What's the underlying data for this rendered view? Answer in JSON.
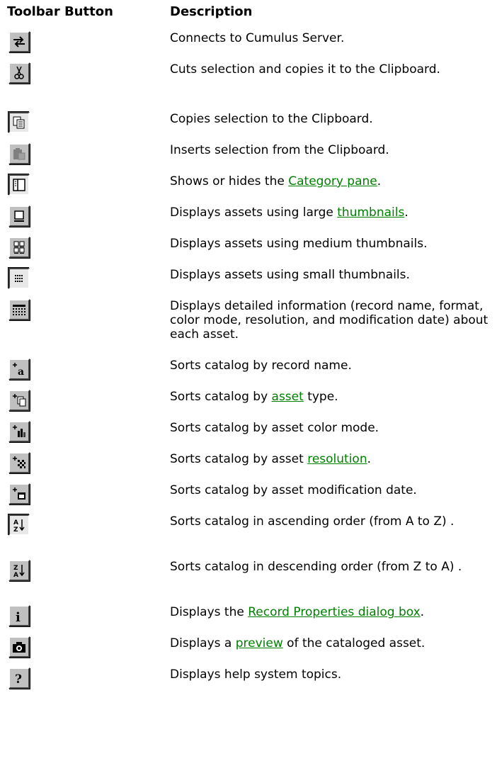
{
  "header": {
    "button_col": "Toolbar Button",
    "desc_col": "Description"
  },
  "rows": [
    {
      "icon": "connect-arrows-icon",
      "pre": "Connects to Cumulus Server.",
      "link": "",
      "post": ""
    },
    {
      "icon": "scissors-icon",
      "pre": "Cuts selection and copies it to the Clipboard.",
      "link": "",
      "post": ""
    },
    {
      "icon": "copy-icon",
      "pre": "Copies selection to the Clipboard.",
      "link": "",
      "post": ""
    },
    {
      "icon": "paste-icon",
      "pre": "Inserts selection from the Clipboard.",
      "link": "",
      "post": ""
    },
    {
      "icon": "category-pane-icon",
      "pre": "Shows or hides the ",
      "link": "Category pane",
      "post": "."
    },
    {
      "icon": "large-thumbnail-icon",
      "pre": "Displays assets using large ",
      "link": "thumbnails",
      "post": "."
    },
    {
      "icon": "medium-thumbnails-icon",
      "pre": "Displays assets using medium thumbnails.",
      "link": "",
      "post": ""
    },
    {
      "icon": "small-thumbnails-icon",
      "pre": "Displays assets using small thumbnails.",
      "link": "",
      "post": ""
    },
    {
      "icon": "details-list-icon",
      "pre": "Displays detailed information (record name, format, color mode, resolution, and modification date) about each asset.",
      "link": "",
      "post": ""
    },
    {
      "icon": "sort-name-icon",
      "pre": "Sorts catalog by record name.",
      "link": "",
      "post": ""
    },
    {
      "icon": "sort-type-icon",
      "pre": "Sorts catalog by ",
      "link": "asset",
      "post": " type."
    },
    {
      "icon": "sort-color-mode-icon",
      "pre": "Sorts catalog by asset color mode.",
      "link": "",
      "post": ""
    },
    {
      "icon": "sort-resolution-icon",
      "pre": "Sorts catalog by asset ",
      "link": "resolution",
      "post": "."
    },
    {
      "icon": "sort-date-icon",
      "pre": "Sorts catalog by asset modification date.",
      "link": "",
      "post": ""
    },
    {
      "icon": "sort-ascending-icon",
      "pre": "Sorts catalog in ascending order (from A to Z) .",
      "link": "",
      "post": ""
    },
    {
      "icon": "sort-descending-icon",
      "pre": "Sorts catalog in descending order (from Z to A) .",
      "link": "",
      "post": ""
    },
    {
      "icon": "info-icon",
      "pre": "Displays the ",
      "link": "Record Properties dialog box",
      "post": "."
    },
    {
      "icon": "camera-icon",
      "pre": "Displays a ",
      "link": "preview",
      "post": " of the cataloged asset."
    },
    {
      "icon": "help-icon",
      "pre": "Displays help system topics.",
      "link": "",
      "post": ""
    }
  ]
}
